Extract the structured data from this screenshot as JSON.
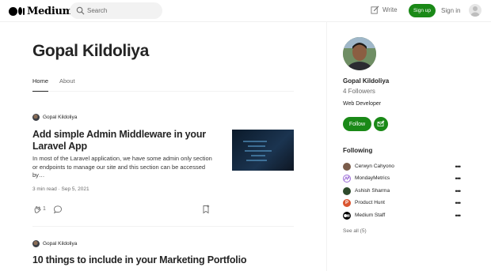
{
  "header": {
    "brand": "Medium",
    "search_placeholder": "Search",
    "write_label": "Write",
    "signup_label": "Sign up",
    "signin_label": "Sign in"
  },
  "profile": {
    "name": "Gopal Kildoliya",
    "tabs": [
      {
        "label": "Home",
        "active": true
      },
      {
        "label": "About",
        "active": false
      }
    ]
  },
  "articles": [
    {
      "author": "Gopal Kildoliya",
      "title": "Add simple Admin Middleware in your Laravel App",
      "excerpt": "In most of the Laravel application, we have some admin only section or endpoints to manage our site and this section can be accessed by…",
      "read_time": "3 min read",
      "date": "Sep 5, 2021",
      "claps": "1"
    },
    {
      "author": "Gopal Kildoliya",
      "title": "10 things to include in your Marketing Portfolio"
    }
  ],
  "sidebar": {
    "name": "Gopal Kildoliya",
    "followers": "4 Followers",
    "bio": "Web Developer",
    "follow_label": "Follow",
    "following_heading": "Following",
    "following": [
      {
        "name": "Cerwyn Cahyono",
        "icon": "avatar-photo",
        "color": "#7a5c4a"
      },
      {
        "name": "MondayMetrics",
        "icon": "mondaymetrics-logo",
        "color": "#9b6bd6"
      },
      {
        "name": "Ashish Sharma",
        "icon": "avatar-photo",
        "color": "#2e4a2c"
      },
      {
        "name": "Product Hunt",
        "icon": "product-hunt-logo",
        "color": "#da552f",
        "letter": "P"
      },
      {
        "name": "Medium Staff",
        "icon": "medium-logo",
        "color": "#000000"
      }
    ],
    "see_all": "See all (5)"
  },
  "colors": {
    "accent_green": "#1a8917",
    "text": "#242424",
    "muted": "#6b6b6b"
  }
}
